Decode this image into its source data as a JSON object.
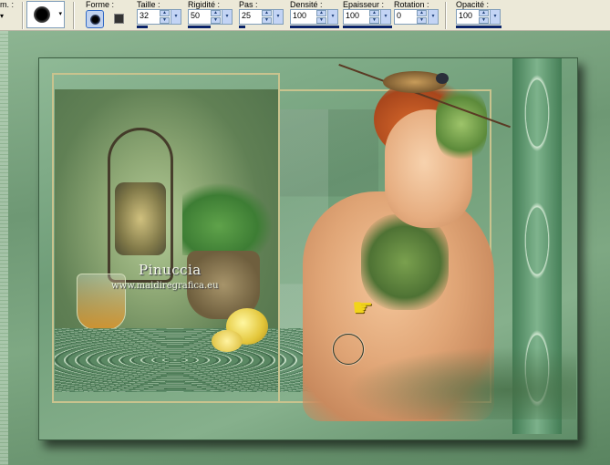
{
  "toolbar": {
    "cut_label": "m. :",
    "preset_arrow": "▾",
    "brush_arrow": "▾",
    "shape": {
      "label": "Forme :",
      "options": [
        "round-shape",
        "square-shape"
      ],
      "selected": "round-shape"
    },
    "size": {
      "label": "Taille :",
      "value": "32"
    },
    "hardness": {
      "label": "Rigidité :",
      "value": "50"
    },
    "step": {
      "label": "Pas :",
      "value": "25"
    },
    "density": {
      "label": "Densité :",
      "value": "100"
    },
    "thickness": {
      "label": "Epaisseur :",
      "value": "100"
    },
    "rotation": {
      "label": "Rotation :",
      "value": "0"
    },
    "opacity": {
      "label": "Opacité :",
      "value": "100"
    },
    "spin_up": "▲",
    "spin_down": "▼",
    "drop_arrow": "▾"
  },
  "canvas": {
    "watermark_name": "Pinuccia",
    "watermark_url": "www.maidiregrafica.eu",
    "cursor_glyph": "☛"
  },
  "colors": {
    "toolbar_bg": "#ece9d8",
    "accent_blue": "#0a246a",
    "canvas_green": "#6f9a76",
    "frame_gold": "#c9c38e"
  }
}
